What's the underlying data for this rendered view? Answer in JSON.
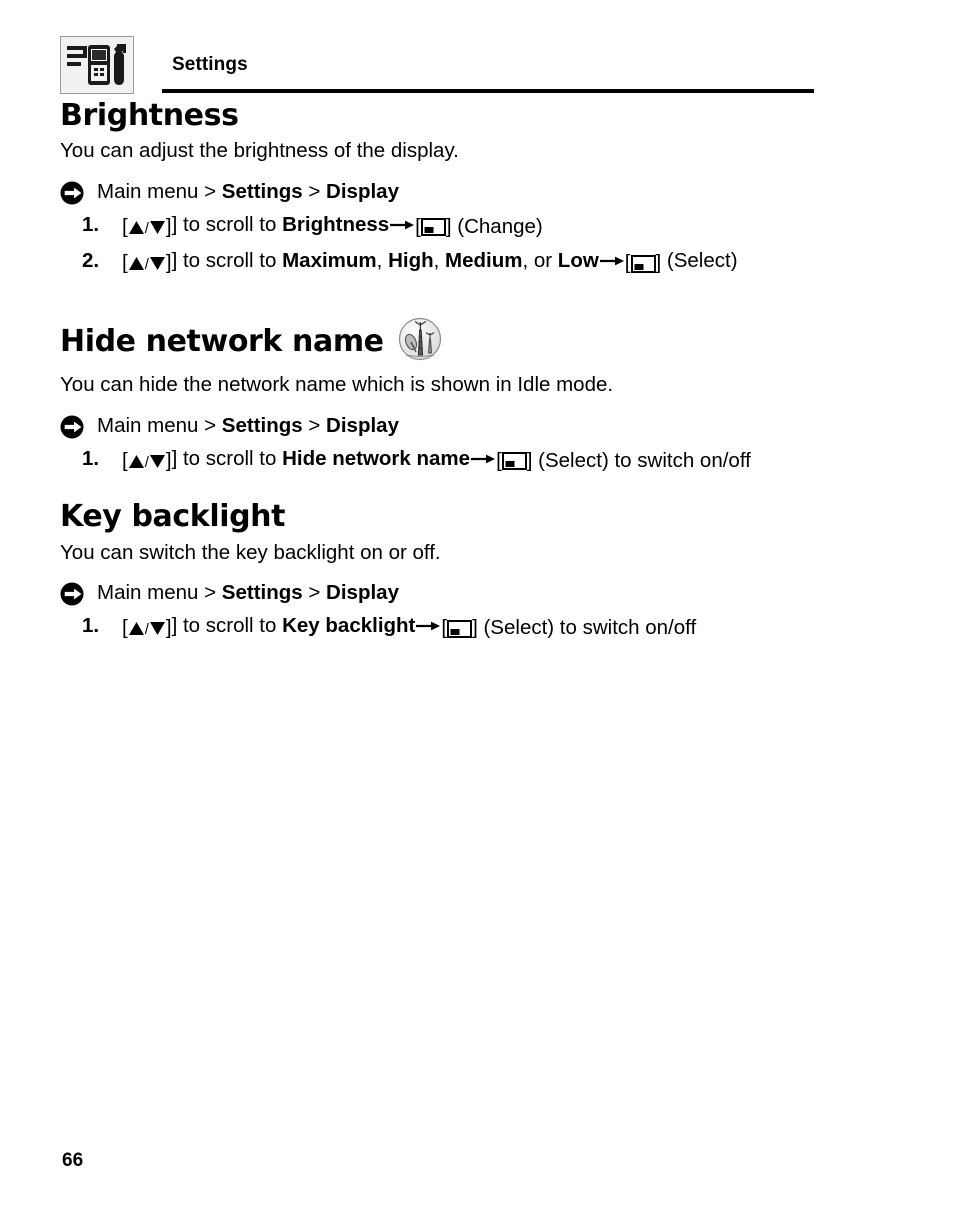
{
  "header": {
    "icon_name": "settings-phone-wrench-icon",
    "title": "Settings"
  },
  "sections": [
    {
      "id": "brightness",
      "title": "Brightness",
      "description": "You can adjust the brightness of the display.",
      "path": {
        "bullet_icon": "circle-right-arrow-icon",
        "root": "Main menu",
        "sep1": " > ",
        "level1": "Settings",
        "sep2": " > ",
        "level2": "Display"
      },
      "steps": [
        {
          "num": "1.",
          "pre": "] to scroll to ",
          "target": "Brightness",
          "mid": "] (Change)",
          "post": ""
        },
        {
          "num": "2.",
          "pre": "] to scroll to ",
          "opt1": "Maximum",
          "comma1": ", ",
          "opt2": "High",
          "comma2": ", ",
          "opt3": "Medium",
          "orword": ", or ",
          "opt4": "Low",
          "mid": "]",
          "post": " (Select)"
        }
      ]
    },
    {
      "id": "hide-network-name",
      "title": "Hide network name",
      "title_icon": "network-tower-icon",
      "description": "You can hide the network name which is shown in Idle mode.",
      "path": {
        "bullet_icon": "circle-right-arrow-icon",
        "root": "Main menu",
        "sep1": " > ",
        "level1": "Settings",
        "sep2": " > ",
        "level2": "Display"
      },
      "steps": [
        {
          "num": "1.",
          "pre": "] to scroll to ",
          "target": "Hide network name",
          "mid": "] (Select) to switch on/off",
          "post": ""
        }
      ]
    },
    {
      "id": "key-backlight",
      "title": "Key backlight",
      "description": "You can switch the key backlight on or off.",
      "path": {
        "bullet_icon": "circle-right-arrow-icon",
        "root": "Main menu",
        "sep1": " > ",
        "level1": "Settings",
        "sep2": " > ",
        "level2": "Display"
      },
      "steps": [
        {
          "num": "1.",
          "pre": "] to scroll to ",
          "target": "Key backlight",
          "mid": "] (Select) to switch on/off",
          "post": ""
        }
      ]
    }
  ],
  "glyphs": {
    "bracket_open": "[",
    "bracket_close": "]",
    "slash": "/",
    "up_key_icon": "up-triangle-key-icon",
    "down_key_icon": "down-triangle-key-icon",
    "arrow_icon": "right-arrow-icon",
    "softkey_icon": "left-softkey-icon"
  },
  "footer": {
    "page_number": "66"
  }
}
